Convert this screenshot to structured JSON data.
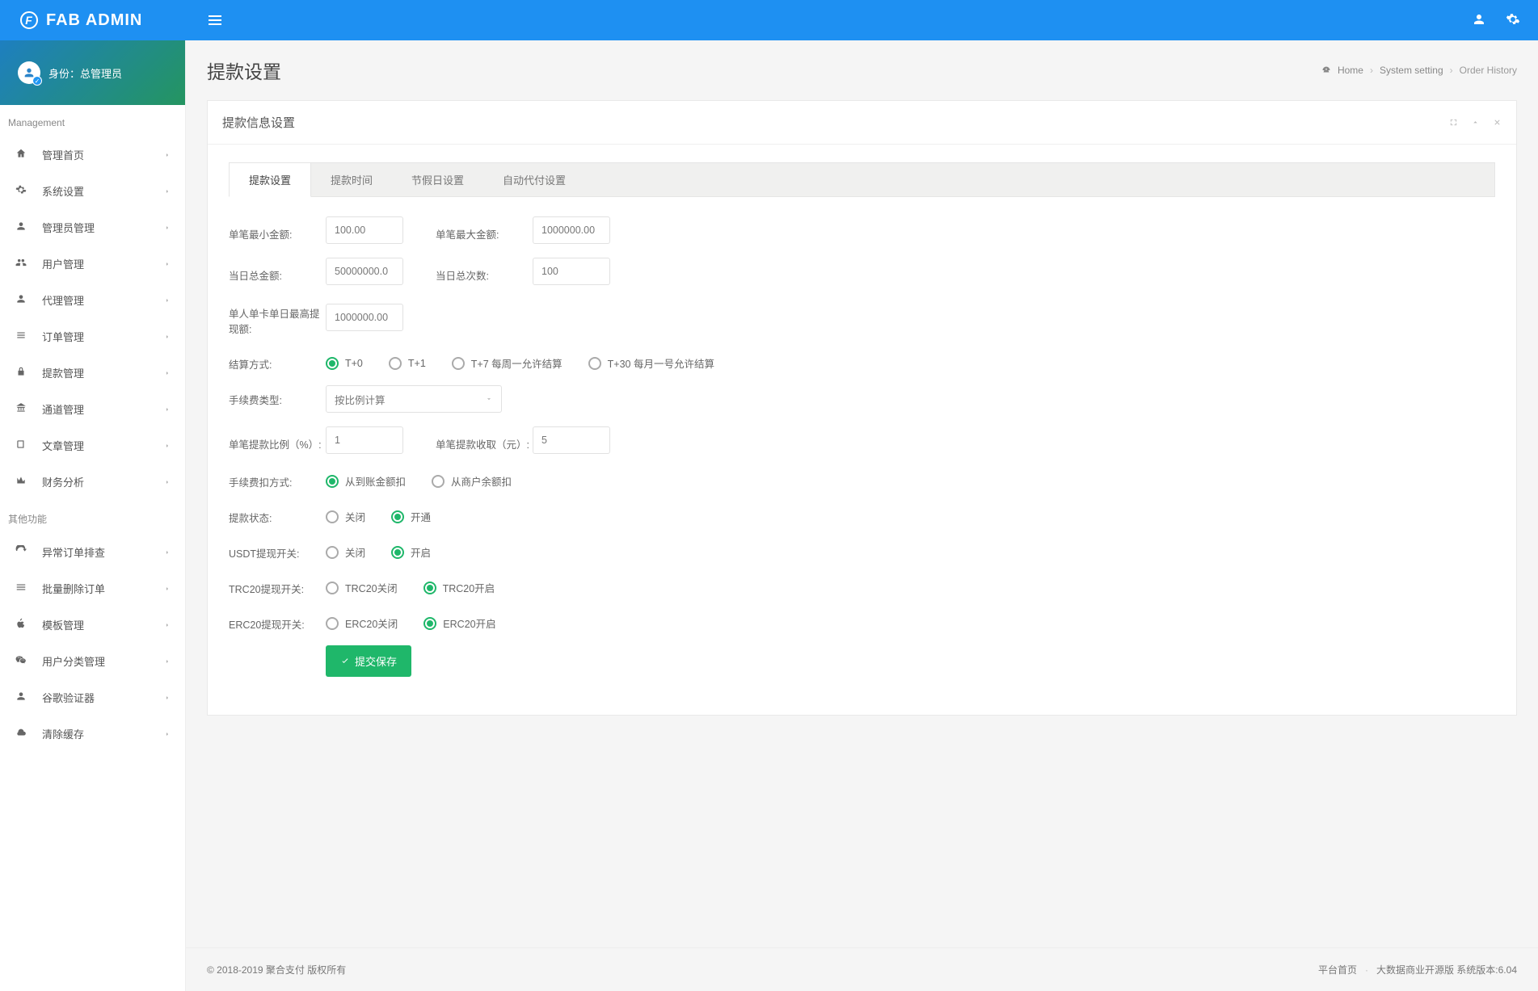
{
  "brand": "FAB ADMIN",
  "sidebar": {
    "bannerText": "身份：总管理员",
    "groups": [
      {
        "heading": "Management",
        "items": [
          {
            "label": "管理首页",
            "icon": "home"
          },
          {
            "label": "系统设置",
            "icon": "gear"
          },
          {
            "label": "管理员管理",
            "icon": "user"
          },
          {
            "label": "用户管理",
            "icon": "users"
          },
          {
            "label": "代理管理",
            "icon": "user"
          },
          {
            "label": "订单管理",
            "icon": "list"
          },
          {
            "label": "提款管理",
            "icon": "lock"
          },
          {
            "label": "通道管理",
            "icon": "bank"
          },
          {
            "label": "文章管理",
            "icon": "book"
          },
          {
            "label": "财务分析",
            "icon": "chart"
          }
        ]
      },
      {
        "heading": "其他功能",
        "items": [
          {
            "label": "异常订单排查",
            "icon": "refresh"
          },
          {
            "label": "批量删除订单",
            "icon": "burger"
          },
          {
            "label": "模板管理",
            "icon": "apple"
          },
          {
            "label": "用户分类管理",
            "icon": "wechat"
          },
          {
            "label": "谷歌验证器",
            "icon": "userx"
          },
          {
            "label": "清除缓存",
            "icon": "cloud"
          }
        ]
      }
    ]
  },
  "page": {
    "title": "提款设置",
    "breadcrumb": [
      "Home",
      "System setting",
      "Order History"
    ]
  },
  "panel": {
    "title": "提款信息设置",
    "tabs": [
      "提款设置",
      "提款时间",
      "节假日设置",
      "自动代付设置"
    ],
    "activeTab": 0
  },
  "form": {
    "minAmount": {
      "label": "单笔最小金额:",
      "value": "100.00"
    },
    "maxAmount": {
      "label": "单笔最大金额:",
      "value": "1000000.00"
    },
    "dayTotal": {
      "label": "当日总金额:",
      "value": "50000000.0"
    },
    "dayCount": {
      "label": "当日总次数:",
      "value": "100"
    },
    "perCardDay": {
      "label": "单人单卡单日最高提现额:",
      "value": "1000000.00"
    },
    "settleMode": {
      "label": "结算方式:",
      "options": [
        "T+0",
        "T+1",
        "T+7 每周一允许结算",
        "T+30 每月一号允许结算"
      ],
      "selected": 0
    },
    "feeType": {
      "label": "手续费类型:",
      "value": "按比例计算"
    },
    "ratio": {
      "label": "单笔提款比例（%）:",
      "value": "1"
    },
    "feeFixed": {
      "label": "单笔提款收取（元）:",
      "value": "5"
    },
    "feeDeduct": {
      "label": "手续费扣方式:",
      "options": [
        "从到账金额扣",
        "从商户余额扣"
      ],
      "selected": 0
    },
    "withdrawStatus": {
      "label": "提款状态:",
      "options": [
        "关闭",
        "开通"
      ],
      "selected": 1
    },
    "usdtSwitch": {
      "label": "USDT提现开关:",
      "options": [
        "关闭",
        "开启"
      ],
      "selected": 1
    },
    "trc20": {
      "label": "TRC20提现开关:",
      "options": [
        "TRC20关闭",
        "TRC20开启"
      ],
      "selected": 1
    },
    "erc20": {
      "label": "ERC20提现开关:",
      "options": [
        "ERC20关闭",
        "ERC20开启"
      ],
      "selected": 1
    },
    "submit": "提交保存"
  },
  "footer": {
    "copyright": "© 2018-2019 聚合支付 版权所有",
    "links": [
      "平台首页",
      "大数据商业开源版 系统版本:6.04"
    ]
  }
}
